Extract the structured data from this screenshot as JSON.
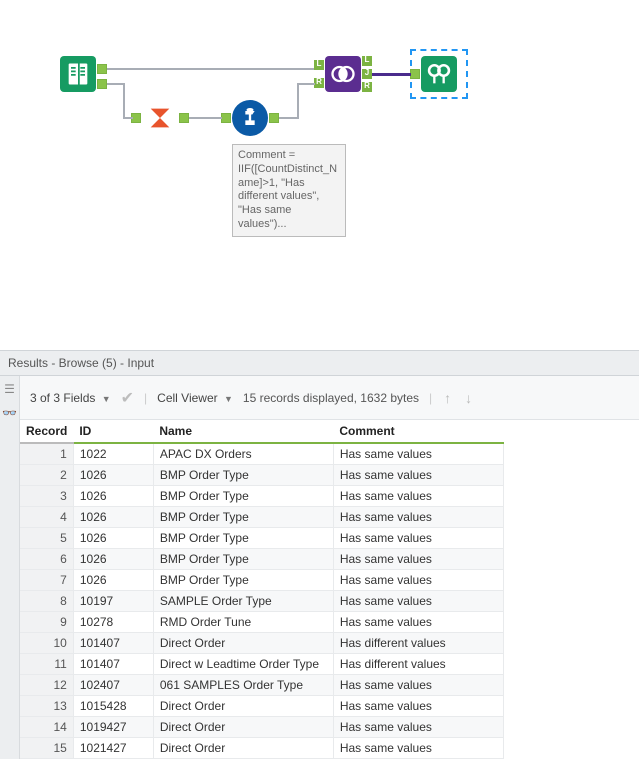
{
  "canvas": {
    "annotation_text": "Comment = IIF([CountDistinct_Name]>1, \"Has different values\", \"Has same values\")..."
  },
  "results": {
    "title": "Results - Browse (5) - Input",
    "fields_summary": "3 of 3 Fields",
    "cell_viewer_label": "Cell Viewer",
    "records_summary": "15 records displayed, 1632 bytes",
    "columns": {
      "record": "Record",
      "id": "ID",
      "name": "Name",
      "comment": "Comment"
    },
    "rows": [
      {
        "n": "1",
        "id": "1022",
        "name": "APAC DX Orders",
        "comment": "Has same values"
      },
      {
        "n": "2",
        "id": "1026",
        "name": "BMP Order Type",
        "comment": "Has same values"
      },
      {
        "n": "3",
        "id": "1026",
        "name": "BMP Order Type",
        "comment": "Has same values"
      },
      {
        "n": "4",
        "id": "1026",
        "name": "BMP Order Type",
        "comment": "Has same values"
      },
      {
        "n": "5",
        "id": "1026",
        "name": "BMP Order Type",
        "comment": "Has same values"
      },
      {
        "n": "6",
        "id": "1026",
        "name": "BMP Order Type",
        "comment": "Has same values"
      },
      {
        "n": "7",
        "id": "1026",
        "name": "BMP Order Type",
        "comment": "Has same values"
      },
      {
        "n": "8",
        "id": "10197",
        "name": "SAMPLE Order Type",
        "comment": "Has same values"
      },
      {
        "n": "9",
        "id": "10278",
        "name": "RMD Order Tune",
        "comment": "Has same values"
      },
      {
        "n": "10",
        "id": "101407",
        "name": "Direct Order",
        "comment": "Has different values"
      },
      {
        "n": "11",
        "id": "101407",
        "name": "Direct w Leadtime Order Type",
        "comment": "Has different values"
      },
      {
        "n": "12",
        "id": "102407",
        "name": "061 SAMPLES Order Type",
        "comment": "Has same values"
      },
      {
        "n": "13",
        "id": "1015428",
        "name": "Direct Order",
        "comment": "Has same values"
      },
      {
        "n": "14",
        "id": "1019427",
        "name": "Direct Order",
        "comment": "Has same values"
      },
      {
        "n": "15",
        "id": "1021427",
        "name": "Direct Order",
        "comment": "Has same values"
      }
    ]
  }
}
